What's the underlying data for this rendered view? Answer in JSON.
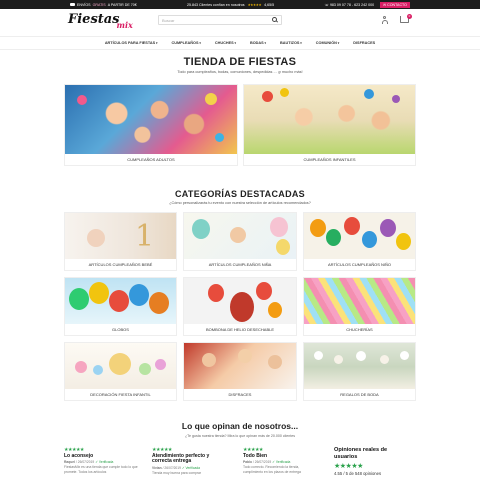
{
  "topbar": {
    "shipping_prefix": "ENVÍOS",
    "shipping_highlight": "GRATIS",
    "shipping_suffix": "A PARTIR DE 70€",
    "trust_text": "25.843 Clientes confían en nosotros",
    "rating": "4,65/5",
    "stars": "★★★★★",
    "phone1": "983 09 07 78",
    "phone2": "623 242 000",
    "contact_label": "CONTACTO"
  },
  "header": {
    "logo_main": "Fiestas",
    "logo_accent": "mix",
    "search_placeholder": "Buscar",
    "cart_count": "0"
  },
  "nav": {
    "items": [
      "ARTÍCULOS PARA FIESTAS",
      "CUMPLEAÑOS",
      "CHUCHES",
      "BODAS",
      "BAUTIZOS",
      "COMUNIÓN",
      "DISFRACES"
    ]
  },
  "hero": {
    "title": "TIENDA DE FIESTAS",
    "subtitle": "Todo para cumpleaños, bodas, comuniones, despedidas ... ¡y mucho más!"
  },
  "main_categories": [
    {
      "label": "CUMPLEAÑOS ADULTOS"
    },
    {
      "label": "CUMPLEAÑOS INFANTILES"
    }
  ],
  "featured": {
    "title": "CATEGORÍAS DESTACADAS",
    "subtitle": "¿Cómo personalizarás tu evento con nuestra selección de artículos recomendados?",
    "items": [
      {
        "label": "ARTÍCULOS CUMPLEAÑOS BEBÉ"
      },
      {
        "label": "ARTÍCULOS CUMPLEAÑOS NIÑA"
      },
      {
        "label": "ARTÍCULOS CUMPLEAÑOS NIÑO"
      },
      {
        "label": "GLOBOS"
      },
      {
        "label": "BOMBONA DE HELIO DESECHABLE"
      },
      {
        "label": "CHUCHERÍAS"
      },
      {
        "label": "DECORACIÓN FIESTA INFANTIL"
      },
      {
        "label": "DISFRACES"
      },
      {
        "label": "REGALOS DE BODA"
      }
    ]
  },
  "opinions": {
    "title": "Lo que opinan de nosotros...",
    "subtitle": "¿Te gusta nuestra tienda? Mira lo que opinan más de 20.000 clientes",
    "reviews": [
      {
        "stars": "★★★★★",
        "title": "Lo aconsejo",
        "author": "Raquel",
        "date": "26/07/2019",
        "verified": "✓ Verificada",
        "body": "FiestasMix es una tienda que cumple todo lo que promete. Todos los artículos"
      },
      {
        "stars": "★★★★★",
        "title": "Atendimiento perfecto y correcta entrega",
        "author": "Vivian",
        "date": "26/07/2019",
        "verified": "✓ Verificada",
        "body": "Tienda muy buena para comprar"
      },
      {
        "stars": "★★★★★",
        "title": "Todo Bien",
        "author": "Pablo",
        "date": "26/07/2019",
        "verified": "✓ Verificada",
        "body": "Todo correcto. Recomiendo la tienda, cumplimiento en los plazos de entrega"
      }
    ],
    "summary": {
      "title": "Opiniones reales de usuarios",
      "stars": "★★★★★",
      "score": "4.55 / 5 de 548 opiniones"
    }
  },
  "colors": {
    "accent": "#d91e64",
    "verified_green": "#2ba24c",
    "topbar_bg": "#1c1c1c"
  }
}
